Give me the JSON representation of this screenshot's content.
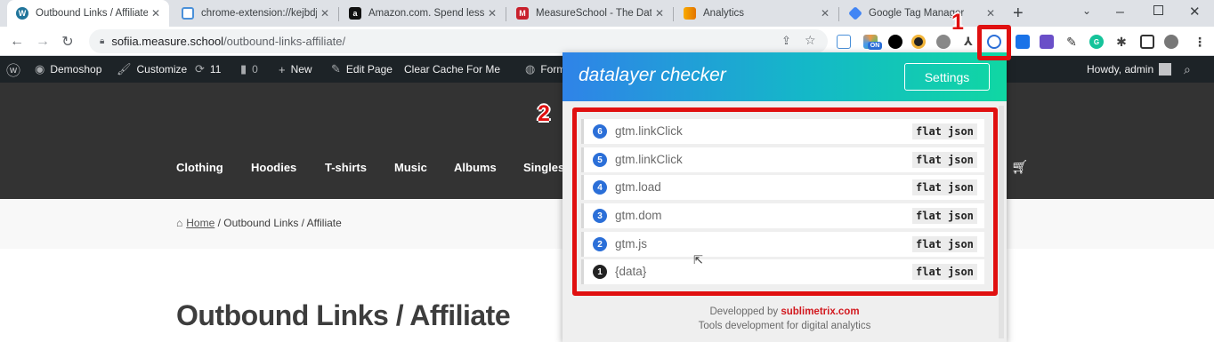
{
  "tabs": [
    {
      "title": "Outbound Links / Affiliate -",
      "icon": "wordpress-icon",
      "active": true
    },
    {
      "title": "chrome-extension://kejbdjr",
      "icon": "extension-page-icon",
      "active": false
    },
    {
      "title": "Amazon.com. Spend less. Sr",
      "icon": "amazon-icon",
      "active": false
    },
    {
      "title": "MeasureSchool - The Data-",
      "icon": "measureschool-icon",
      "active": false
    },
    {
      "title": "Analytics",
      "icon": "analytics-icon",
      "active": false
    },
    {
      "title": "Google Tag Manager",
      "icon": "gtm-icon",
      "active": false
    }
  ],
  "url": {
    "host": "sofiia.measure.school",
    "path": "/outbound-links-affiliate/"
  },
  "extensions": {
    "on_label": "ON",
    "badge_6": "6",
    "badge_24": "24"
  },
  "adminbar": {
    "site": "Demoshop",
    "customize": "Customize",
    "updates": "11",
    "comments": "0",
    "new": "New",
    "edit_page": "Edit Page",
    "clear_cache": "Clear Cache For Me",
    "forms": "Form",
    "howdy": "Howdy, admin"
  },
  "nav": [
    "Clothing",
    "Hoodies",
    "T-shirts",
    "Music",
    "Albums",
    "Singles"
  ],
  "breadcrumb": {
    "home": "Home",
    "rest": " / Outbound Links / Affiliate"
  },
  "page_title": "Outbound Links / Affiliate",
  "popup": {
    "title": "datalayer checker",
    "settings_label": "Settings",
    "flat_label": "flat",
    "json_label": "json",
    "rows": [
      {
        "num": "6",
        "event": "gtm.linkClick",
        "color": "#2b6fd8"
      },
      {
        "num": "5",
        "event": "gtm.linkClick",
        "color": "#2b6fd8"
      },
      {
        "num": "4",
        "event": "gtm.load",
        "color": "#2b6fd8"
      },
      {
        "num": "3",
        "event": "gtm.dom",
        "color": "#2b6fd8"
      },
      {
        "num": "2",
        "event": "gtm.js",
        "color": "#2b6fd8"
      },
      {
        "num": "1",
        "event": "{data}",
        "color": "#222222"
      }
    ],
    "credits_prefix": "Developped by ",
    "credits_brand": "sublimetrix.com",
    "credits_line2": "Tools development for digital analytics"
  },
  "annotations": {
    "label1": "1",
    "label2": "2",
    "color": "#e01010"
  }
}
